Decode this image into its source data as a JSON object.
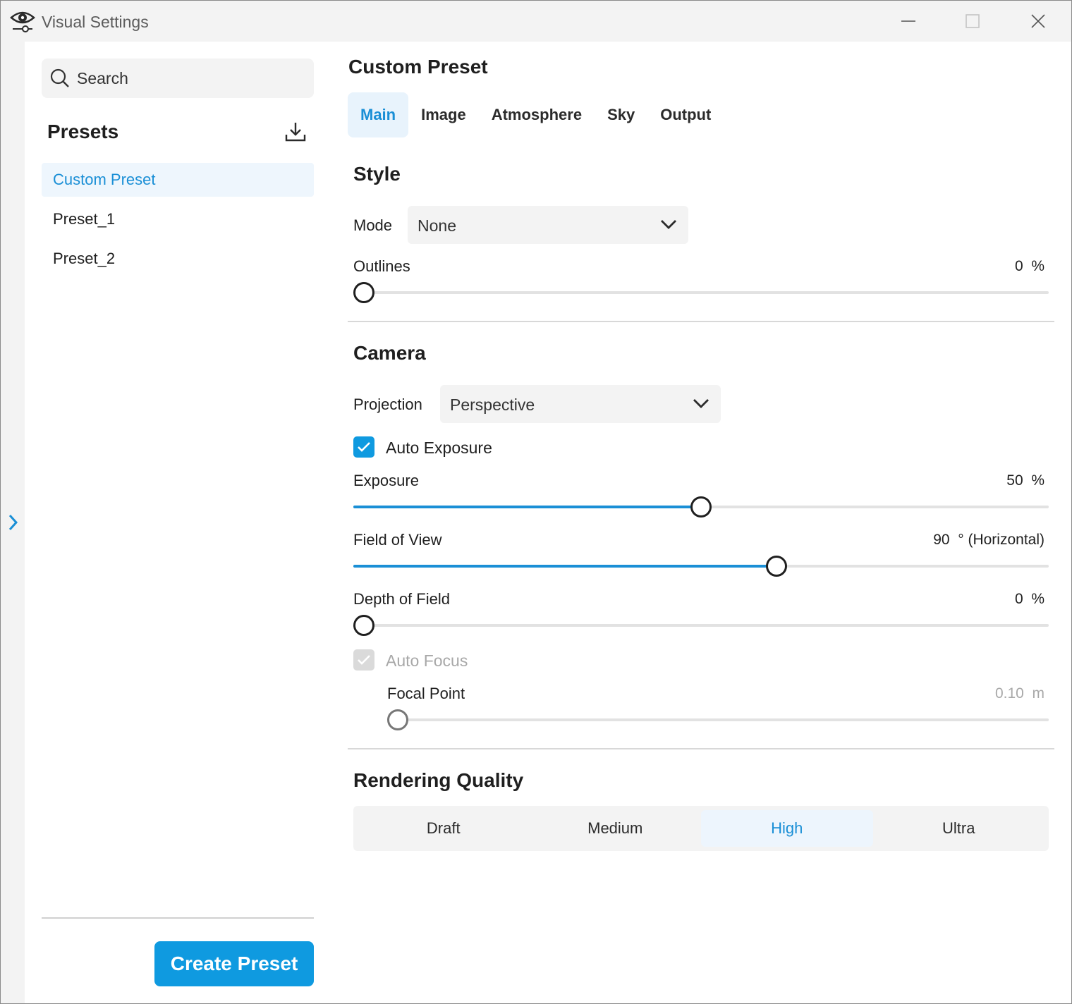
{
  "window": {
    "title": "Visual Settings",
    "app_icon": "eye-settings-icon"
  },
  "sidebar": {
    "search": {
      "placeholder": "Search",
      "value": ""
    },
    "presets_header": "Presets",
    "presets": [
      "Custom Preset",
      "Preset_1",
      "Preset_2"
    ],
    "active_preset": "Custom Preset",
    "create_button": "Create Preset"
  },
  "main": {
    "title": "Custom Preset",
    "tabs": [
      "Main",
      "Image",
      "Atmosphere",
      "Sky",
      "Output"
    ],
    "active_tab": "Main",
    "style": {
      "title": "Style",
      "mode_label": "Mode",
      "mode_value": "None",
      "outlines": {
        "label": "Outlines",
        "value": "0",
        "unit": "%",
        "fraction": 0
      }
    },
    "camera": {
      "title": "Camera",
      "projection_label": "Projection",
      "projection_value": "Perspective",
      "auto_exposure": {
        "label": "Auto Exposure",
        "checked": true
      },
      "exposure": {
        "label": "Exposure",
        "value": "50",
        "unit": "%",
        "fraction": 0.5
      },
      "fov": {
        "label": "Field of View",
        "value": "90",
        "unit": "° (Horizontal)",
        "fraction": 0.612
      },
      "dof": {
        "label": "Depth of Field",
        "value": "0",
        "unit": "%",
        "fraction": 0
      },
      "auto_focus": {
        "label": "Auto Focus",
        "checked": true,
        "disabled": true
      },
      "focal_point": {
        "label": "Focal Point",
        "value": "0.10",
        "unit": "m",
        "fraction": 0
      }
    },
    "rendering": {
      "title": "Rendering Quality",
      "options": [
        "Draft",
        "Medium",
        "High",
        "Ultra"
      ],
      "selected": "High"
    }
  },
  "colors": {
    "accent": "#0f9ae0",
    "accent_text": "#1a8fd6",
    "selected_bg": "#eef6fd"
  }
}
